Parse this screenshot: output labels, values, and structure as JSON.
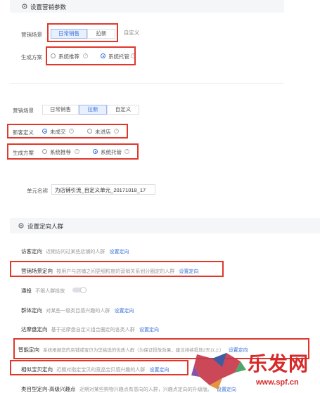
{
  "section1": {
    "title": "设置营销参数",
    "scene_label": "营销场景",
    "scene_options": [
      "日常销售",
      "拉新",
      "自定义"
    ],
    "plan_label": "生成方案",
    "plan_options": [
      "系统推荐",
      "系统托管"
    ]
  },
  "section2": {
    "scene_label": "营销场景",
    "scene_options": [
      "日常销售",
      "拉新",
      "自定义"
    ],
    "newcust_label": "新客定义",
    "newcust_options": [
      "未成交",
      "未进店"
    ],
    "plan_label": "生成方案",
    "plan_options": [
      "系统推荐",
      "系统托管"
    ]
  },
  "unit": {
    "label": "单元名称",
    "value": "为店铺引流_自定义单元_20171018_17"
  },
  "targeting": {
    "title": "设置定向人群",
    "rows": [
      {
        "name": "访客定向",
        "desc": "近期访问过某些店铺的人群",
        "link": "设置定向"
      },
      {
        "name": "营销场景定向",
        "desc": "按用户与店铺之间更细粒度的营销关系划分圈定的人群",
        "link": "设置定向"
      },
      {
        "name": "通投",
        "desc": "不限人群投放",
        "link": ""
      },
      {
        "name": "群体定向",
        "desc": "对某些一级类目感兴趣的人群",
        "link": "设置定向"
      },
      {
        "name": "达摩盘定向",
        "desc": "基于达摩盘自定义组合圈定的各类人群",
        "link": "设置定向"
      },
      {
        "name": "智能定向",
        "desc": "系统根据您的店铺或宝贝为您挑选的优质人群（为保证投放效果，建议持续投放2天以上）",
        "link": "设置定向"
      },
      {
        "name": "相似宝贝定向",
        "desc": "近期对指定宝贝的竞品宝贝感兴趣的人群",
        "link": "设置定向"
      },
      {
        "name": "类目型定向-高级兴趣点",
        "desc": "近期对某些购物兴趣点有意向的人群，兴趣点定向的升级版。",
        "link": "设置定向"
      }
    ]
  },
  "watermark": {
    "text": "乐发网",
    "url": "www.spf.cn"
  },
  "colors": {
    "accent": "#3b72d8",
    "highlight_red": "#e0382b",
    "active_bg": "#e8f0fe"
  }
}
